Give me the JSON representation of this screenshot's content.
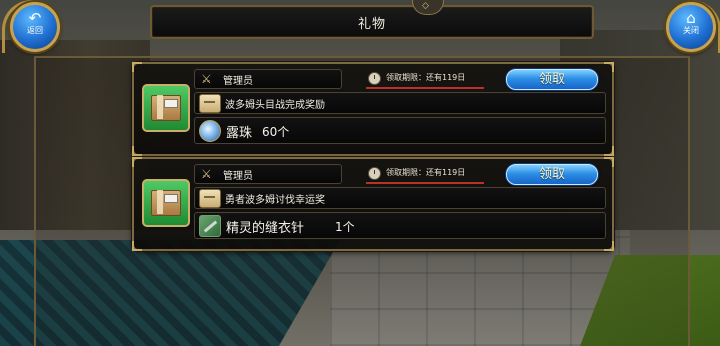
{
  "header": {
    "title": "礼物",
    "back_label": "返回",
    "close_label": "关闭"
  },
  "mails": [
    {
      "sender": "管理员",
      "deadline": "领取期限：还有119日",
      "claim_label": "领取",
      "subject": "波多姆头目战完成奖励",
      "reward_name": "露珠",
      "reward_qty": "60个",
      "reward_icon": "pearl-icon"
    },
    {
      "sender": "管理员",
      "deadline": "领取期限：还有119日",
      "claim_label": "领取",
      "subject": "勇者波多姆讨伐幸运奖",
      "reward_name": "精灵的缝衣针",
      "reward_qty": "1个",
      "reward_icon": "needle-icon"
    }
  ],
  "colors": {
    "claim_button": "#2e8fe6",
    "frame_gold": "#c9ac63",
    "deadline_underline": "#b8322a",
    "gift_box_bg": "#1f8a33"
  }
}
